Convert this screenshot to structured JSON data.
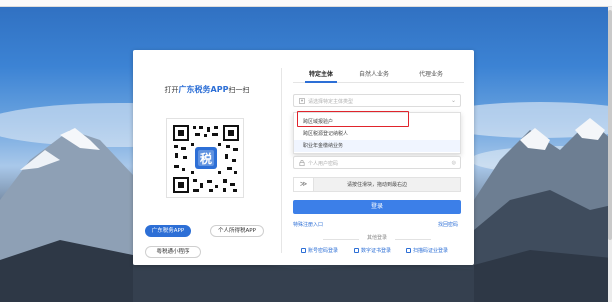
{
  "left_panel": {
    "scan_prefix": "打开",
    "scan_brand": "广东税务APP",
    "scan_suffix": "扫一扫",
    "buttons": [
      "广东税务APP",
      "个人所得税APP",
      "粤税通小程序"
    ]
  },
  "tabs": [
    {
      "label": "特定主体",
      "active": true
    },
    {
      "label": "自然人业务",
      "active": false
    },
    {
      "label": "代理业务",
      "active": false
    }
  ],
  "form": {
    "select_placeholder": "请选择特定主体类型",
    "password_placeholder": "个人用户密码",
    "slider_text": "请按住滑块，拖动到最右边",
    "login_label": "登录"
  },
  "dropdown_options": [
    "跨区域报验户",
    "跨区税源登记纳税人",
    "职业年金缴纳业务"
  ],
  "links": {
    "forgot": "找回密码",
    "register_left": "特殊注册入口",
    "other_login": "其他登录"
  },
  "bottom_links": [
    "账号密码登录",
    "数字证书登录",
    "扫描码证业登录"
  ],
  "colors": {
    "primary": "#2d6fd6",
    "highlight": "#e0242c"
  }
}
